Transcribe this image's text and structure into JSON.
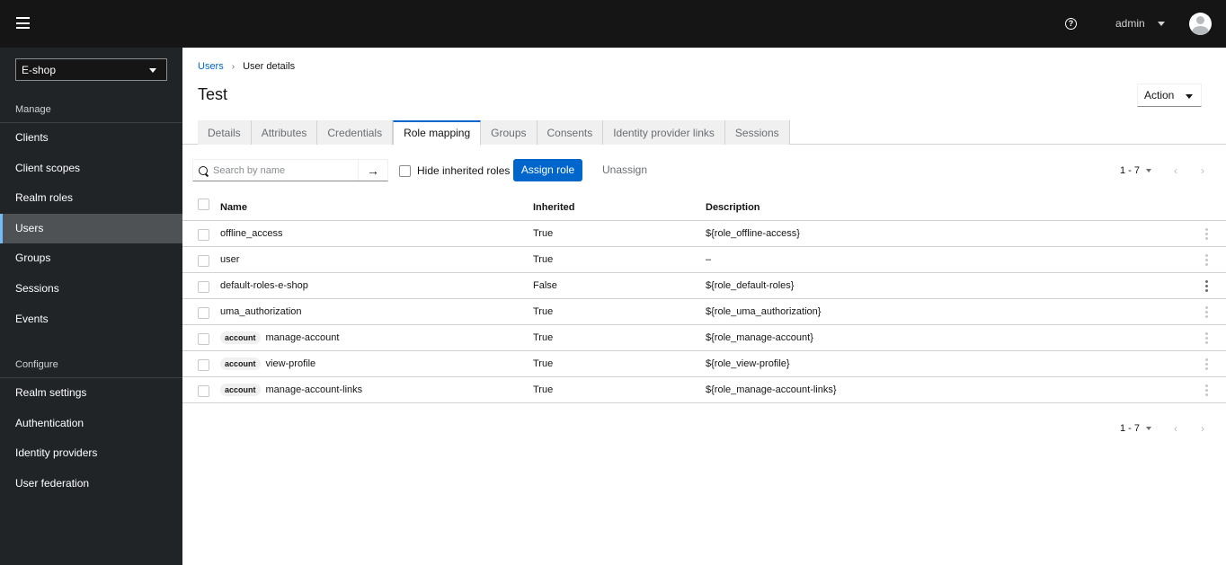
{
  "header": {
    "user_name": "admin"
  },
  "sidebar": {
    "realm": "E-shop",
    "manage_title": "Manage",
    "manage_items": [
      {
        "label": "Clients"
      },
      {
        "label": "Client scopes"
      },
      {
        "label": "Realm roles"
      },
      {
        "label": "Users",
        "active": true
      },
      {
        "label": "Groups"
      },
      {
        "label": "Sessions"
      },
      {
        "label": "Events"
      }
    ],
    "configure_title": "Configure",
    "configure_items": [
      {
        "label": "Realm settings"
      },
      {
        "label": "Authentication"
      },
      {
        "label": "Identity providers"
      },
      {
        "label": "User federation"
      }
    ]
  },
  "breadcrumb": {
    "parent": "Users",
    "current": "User details"
  },
  "page": {
    "title": "Test",
    "action_label": "Action"
  },
  "tabs": [
    {
      "label": "Details"
    },
    {
      "label": "Attributes"
    },
    {
      "label": "Credentials"
    },
    {
      "label": "Role mapping",
      "active": true
    },
    {
      "label": "Groups"
    },
    {
      "label": "Consents"
    },
    {
      "label": "Identity provider links"
    },
    {
      "label": "Sessions"
    }
  ],
  "toolbar": {
    "search_placeholder": "Search by name",
    "search_value": "",
    "hide_inherited_label": "Hide inherited roles",
    "hide_inherited_checked": false,
    "assign_label": "Assign role",
    "unassign_label": "Unassign",
    "pagination_range": "1 - 7"
  },
  "table": {
    "columns": {
      "name": "Name",
      "inherited": "Inherited",
      "description": "Description"
    },
    "rows": [
      {
        "client": "",
        "name": "offline_access",
        "inherited": "True",
        "description": "${role_offline-access}"
      },
      {
        "client": "",
        "name": "user",
        "inherited": "True",
        "description": "–"
      },
      {
        "client": "",
        "name": "default-roles-e-shop",
        "inherited": "False",
        "description": "${role_default-roles}"
      },
      {
        "client": "",
        "name": "uma_authorization",
        "inherited": "True",
        "description": "${role_uma_authorization}"
      },
      {
        "client": "account",
        "name": "manage-account",
        "inherited": "True",
        "description": "${role_manage-account}"
      },
      {
        "client": "account",
        "name": "view-profile",
        "inherited": "True",
        "description": "${role_view-profile}"
      },
      {
        "client": "account",
        "name": "manage-account-links",
        "inherited": "True",
        "description": "${role_manage-account-links}"
      }
    ]
  },
  "footer": {
    "pagination_range": "1 - 7"
  },
  "colors": {
    "accent": "#0066cc",
    "masthead": "#151515",
    "sidebar": "#212427",
    "sidebar_active": "#4f5255",
    "active_indicator": "#73bcf7"
  }
}
